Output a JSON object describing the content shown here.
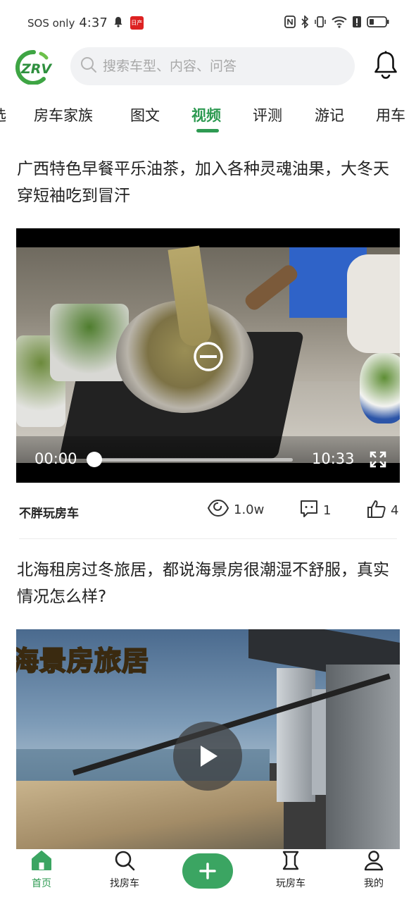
{
  "status_bar": {
    "carrier": "SOS only",
    "time": "4:37",
    "app_badge": "日产"
  },
  "header": {
    "logo_text": "ZRV",
    "search_placeholder": "搜索车型、内容、问答"
  },
  "tabs": [
    {
      "label": "选"
    },
    {
      "label": "房车家族"
    },
    {
      "label": "图文"
    },
    {
      "label": "视频",
      "active": true
    },
    {
      "label": "评测"
    },
    {
      "label": "游记"
    },
    {
      "label": "用车"
    }
  ],
  "posts": [
    {
      "title": "广西特色早餐平乐油茶，加入各种灵魂油果，大冬天穿短袖吃到冒汗",
      "video": {
        "current_time": "00:00",
        "duration": "10:33",
        "progress_fraction": 0.0
      },
      "author": "不胖玩房车",
      "views": "1.0w",
      "comments": "1",
      "likes": "4"
    },
    {
      "title": "北海租房过冬旅居，都说海景房很潮湿不舒服，真实情况怎么样?",
      "video": {
        "caption": "海景房旅居"
      }
    }
  ],
  "bottom_nav": [
    {
      "label": "首页",
      "icon": "home-icon",
      "active": true
    },
    {
      "label": "找房车",
      "icon": "search-icon"
    },
    {
      "label": "",
      "icon": "plus-icon"
    },
    {
      "label": "玩房车",
      "icon": "flag-icon"
    },
    {
      "label": "我的",
      "icon": "user-icon"
    }
  ],
  "colors": {
    "accent": "#2e9a52",
    "add_button": "#3ba562"
  }
}
